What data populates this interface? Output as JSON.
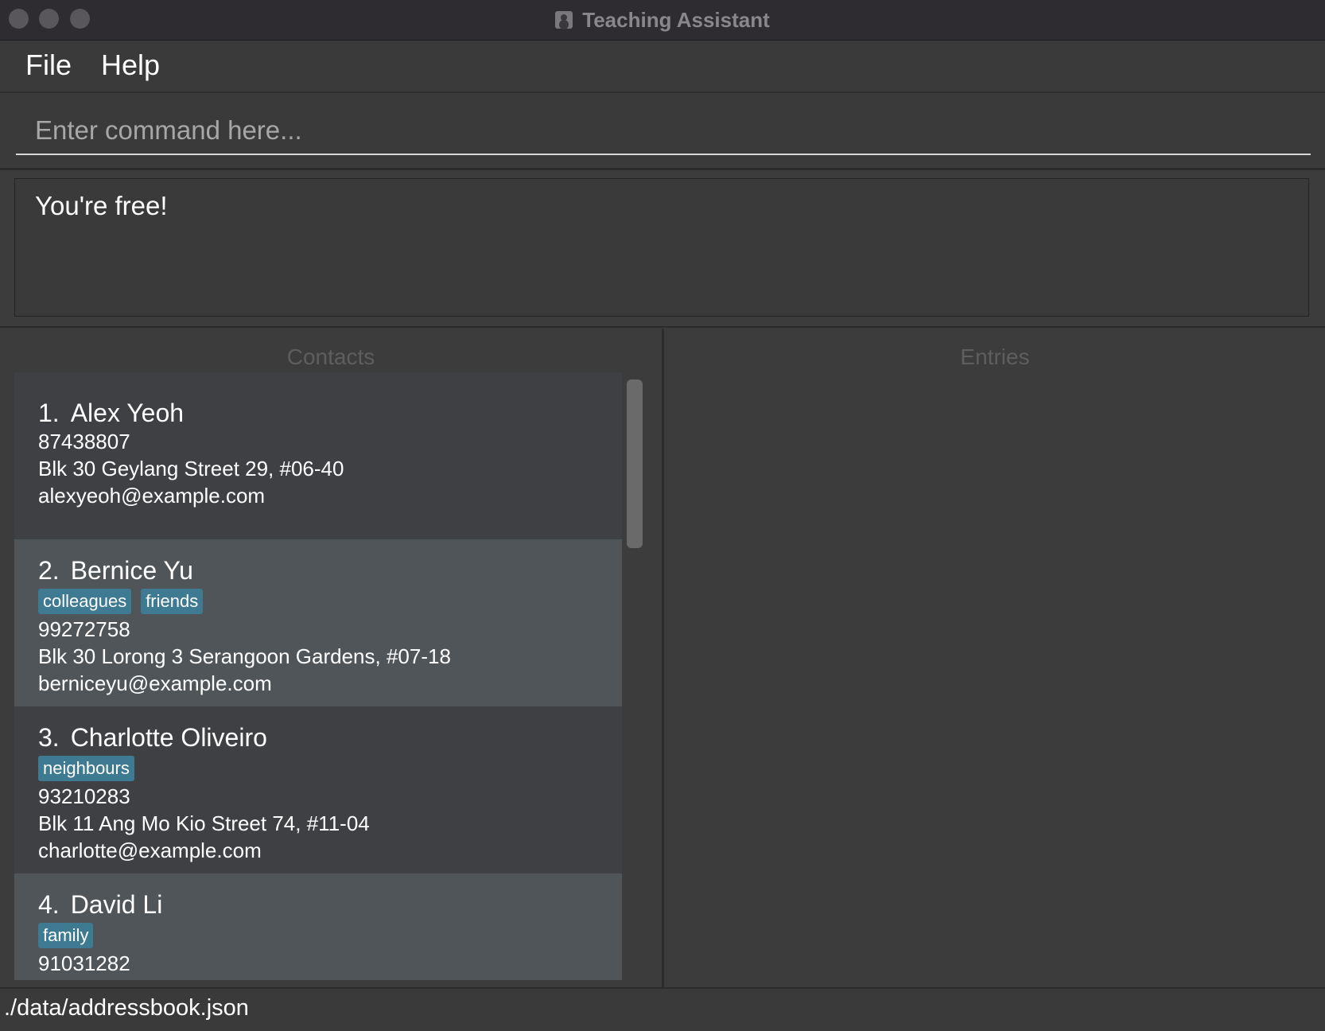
{
  "window": {
    "title": "Teaching Assistant"
  },
  "menu": {
    "file": "File",
    "help": "Help"
  },
  "command": {
    "placeholder": "Enter command here...",
    "value": ""
  },
  "result": {
    "message": "You're free!"
  },
  "contacts": {
    "header": "Contacts",
    "items": [
      {
        "index": "1.",
        "name": "Alex Yeoh",
        "tags": [],
        "phone": "87438807",
        "address": "Blk 30 Geylang Street 29, #06-40",
        "email": "alexyeoh@example.com"
      },
      {
        "index": "2.",
        "name": "Bernice Yu",
        "tags": [
          "colleagues",
          "friends"
        ],
        "phone": "99272758",
        "address": "Blk 30 Lorong 3 Serangoon Gardens, #07-18",
        "email": "berniceyu@example.com"
      },
      {
        "index": "3.",
        "name": "Charlotte Oliveiro",
        "tags": [
          "neighbours"
        ],
        "phone": "93210283",
        "address": "Blk 11 Ang Mo Kio Street 74, #11-04",
        "email": "charlotte@example.com"
      },
      {
        "index": "4.",
        "name": "David Li",
        "tags": [
          "family"
        ],
        "phone": "91031282",
        "address": "",
        "email": ""
      }
    ]
  },
  "entries": {
    "header": "Entries"
  },
  "status": {
    "file_path": "./data/addressbook.json"
  },
  "colors": {
    "tag_background": "#3e7a91",
    "card_odd": "#3f4044",
    "card_even": "#50555a"
  }
}
